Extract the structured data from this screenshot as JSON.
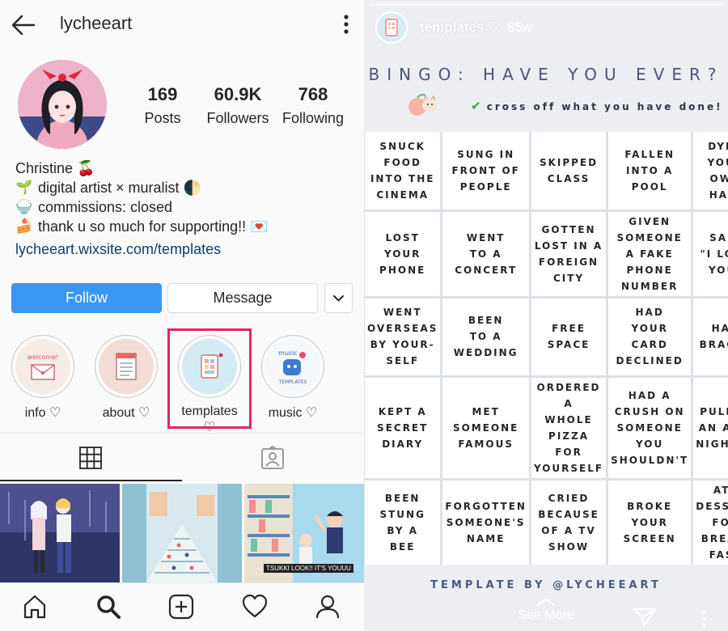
{
  "profile": {
    "username": "lycheeart",
    "stats": [
      {
        "value": "169",
        "label": "Posts"
      },
      {
        "value": "60.9K",
        "label": "Followers"
      },
      {
        "value": "768",
        "label": "Following"
      }
    ],
    "bio": {
      "name": "Christine 🍒",
      "lines": [
        {
          "emoji": "🌱",
          "text": "digital artist × muralist 🌓"
        },
        {
          "emoji": "🍚",
          "text": "commissions: closed"
        },
        {
          "emoji": "🍰",
          "text": "thank u so much for supporting!! 💌"
        }
      ],
      "link": "lycheeart.wixsite.com/templates"
    },
    "buttons": {
      "follow": "Follow",
      "message": "Message"
    },
    "highlights": [
      {
        "label": "info ♡",
        "color": "#f6ece6",
        "icon": "envelope-icon"
      },
      {
        "label": "about ♡",
        "color": "#f3dcd6",
        "icon": "notepad-icon"
      },
      {
        "label": "templates ♡",
        "color": "#d3ebf2",
        "icon": "template-icon",
        "selected": true
      },
      {
        "label": "music ♡",
        "color": "#f5f8fa",
        "icon": "music-character-icon"
      }
    ],
    "posts": [
      {
        "caption": "",
        "colors": [
          "#3a3f7a",
          "#7d6aa3",
          "#c9c4e4"
        ]
      },
      {
        "caption": "",
        "colors": [
          "#cbe3ee",
          "#7fb3c8",
          "#e0d6c8"
        ]
      },
      {
        "caption": "TSUKKI LOOK!! IT'S YOUUU",
        "colors": [
          "#b6dff0",
          "#e9d8c3",
          "#5a86b5"
        ]
      }
    ]
  },
  "story": {
    "name": "templates ♡",
    "time": "85w",
    "title": "BINGO: HAVE YOU EVER?",
    "subtitle": "cross off what you have done!",
    "cells": [
      "SNUCK\nFOOD\nINTO THE\nCINEMA",
      "SUNG IN\nFRONT OF\nPEOPLE",
      "SKIPPED\nCLASS",
      "FALLEN\nINTO A\nPOOL",
      "DYED\nYOUR\nOWN\nHAIR",
      "LOST\nYOUR\nPHONE",
      "WENT\nTO A\nCONCERT",
      "GOTTEN\nLOST IN A\nFOREIGN\nCITY",
      "GIVEN\nSOMEONE\nA FAKE\nPHONE\nNUMBER",
      "SAID\n\"I LOVE\nYOU\"",
      "WENT\nOVERSEAS\nBY YOUR-\nSELF",
      "BEEN\nTO A\nWEDDING",
      "FREE\nSPACE",
      "HAD\nYOUR CARD\nDECLINED",
      "HAD\nBRACES",
      "KEPT A\nSECRET\nDIARY",
      "MET\nSOMEONE\nFAMOUS",
      "ORDERED A\nWHOLE\nPIZZA FOR\nYOURSELF",
      "HAD A\nCRUSH ON\nSOMEONE\nYOU\nSHOULDN'T",
      "PULLED\nAN ALL-\nNIGHTER",
      "BEEN\nSTUNG\nBY A\nBEE",
      "FORGOTTEN\nSOMEONE'S\nNAME",
      "CRIED\nBECAUSE\nOF A TV\nSHOW",
      "BROKE\nYOUR\nSCREEN",
      "ATE\nDESSERT\nFOR\nBREAK-\nFAST"
    ],
    "credit": "TEMPLATE BY @LYCHEEART",
    "see_more": "See More"
  },
  "colors": {
    "follow_blue": "#3897f0",
    "highlight_frame": "#e0266d",
    "bingo_title": "#49567a"
  }
}
